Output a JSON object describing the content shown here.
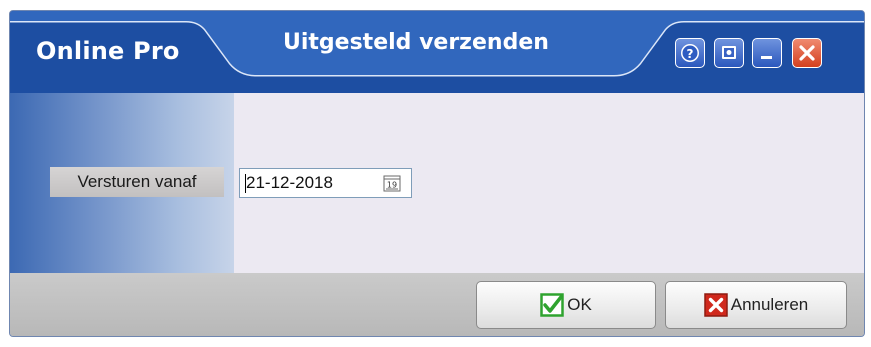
{
  "window": {
    "app_name": "Online Pro",
    "title": "Uitgesteld verzenden"
  },
  "titlebar_buttons": {
    "help_icon": "question-icon",
    "screen_icon": "screen-icon",
    "minimize_icon": "minimize-icon",
    "close_icon": "close-icon"
  },
  "form": {
    "send_from_label": "Versturen vanaf",
    "send_from_value": "21-12-2018",
    "calendar_icon": "calendar-icon",
    "calendar_glyph": "19"
  },
  "footer": {
    "ok_label": "OK",
    "cancel_label": "Annuleren"
  },
  "colors": {
    "titlebar": "#1c4fa3",
    "content_bg": "#ece9f2",
    "ok_check": "#2fa32f",
    "cancel_x": "#d0281c"
  }
}
